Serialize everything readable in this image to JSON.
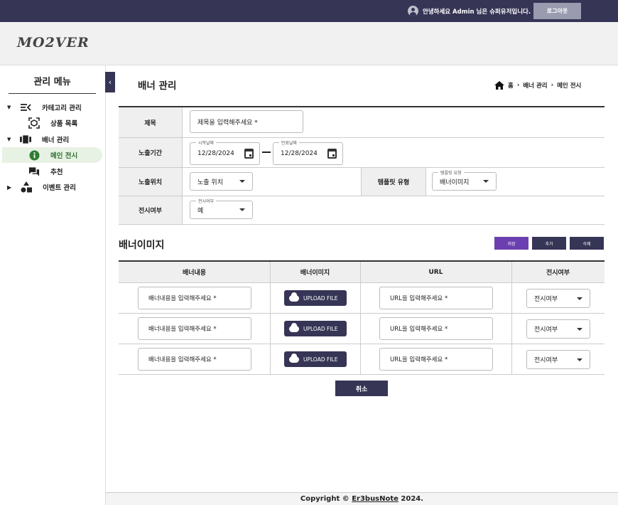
{
  "topbar": {
    "greeting": "안녕하세요 Admin 님은 슈퍼유저입니다.",
    "logout_label": "로그아웃",
    "bg_color": "#363556"
  },
  "header": {
    "logo": "MO2VER"
  },
  "sidebar": {
    "title": "관리 메뉴",
    "items": [
      {
        "label": "카테고리 관리",
        "icon": "category-icon",
        "expanded": true
      },
      {
        "label": "상품 목록",
        "icon": "product-icon"
      },
      {
        "label": "배너 관리",
        "icon": "banner-icon",
        "expanded": true
      },
      {
        "label": "메인 전시",
        "icon": "info-icon",
        "active": true
      },
      {
        "label": "추천",
        "icon": "chat-icon"
      },
      {
        "label": "이벤트 관리",
        "icon": "shapes-icon",
        "expanded": false
      }
    ]
  },
  "page": {
    "title": "배너 관리",
    "breadcrumb": [
      "홈",
      "배너 관리",
      "메인 전시"
    ]
  },
  "form": {
    "title_label": "제목",
    "title_placeholder": "제목을 입력해주세요 *",
    "period_label": "노출기간",
    "start_legend": "시작날짜",
    "start_date": "12/28/2024",
    "end_legend": "만료날짜",
    "end_date": "12/28/2024",
    "position_label": "노출위치",
    "position_value": "노출 위치",
    "template_label": "템플릿 유형",
    "template_legend": "템플릿 유형",
    "template_value": "배너이미지",
    "display_label": "전시여부",
    "display_legend": "전시여부",
    "display_value": "예"
  },
  "banner_section": {
    "title": "배너이미지",
    "save_label": "저장",
    "add_label": "추가",
    "delete_label": "삭제",
    "save_color": "#6c3fb0",
    "columns": [
      "배너내용",
      "배너이미지",
      "URL",
      "전시여부"
    ],
    "rows": [
      {
        "content_placeholder": "배너내용을 입력해주세요 *",
        "upload_label": "UPLOAD FILE",
        "url_placeholder": "URL을 입력해주세요 *",
        "display_placeholder": "전시여부"
      },
      {
        "content_placeholder": "배너내용을 입력해주세요 *",
        "upload_label": "UPLOAD FILE",
        "url_placeholder": "URL을 입력해주세요 *",
        "display_placeholder": "전시여부"
      },
      {
        "content_placeholder": "배너내용을 입력해주세요 *",
        "upload_label": "UPLOAD FILE",
        "url_placeholder": "URL을 입력해주세요 *",
        "display_placeholder": "전시여부"
      }
    ],
    "cancel_label": "취소"
  },
  "footer": {
    "prefix": "Copyright © ",
    "link": "Er3busNote",
    "suffix": " 2024."
  }
}
